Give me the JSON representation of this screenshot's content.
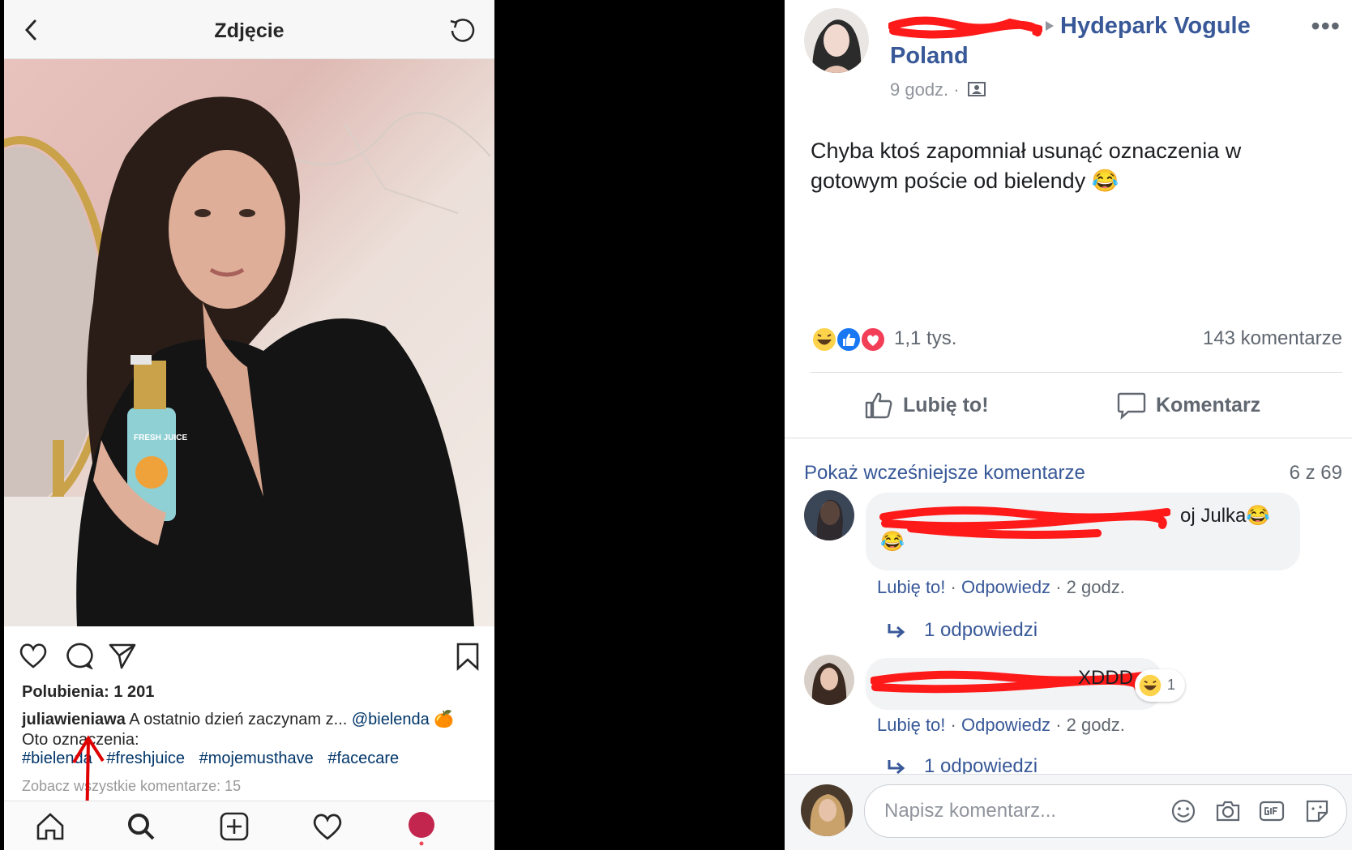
{
  "instagram": {
    "title": "Zdjęcie",
    "bottle_text": "FRESH JUICE",
    "likes": "Polubienia: 1 201",
    "caption_user": "juliawieniawa",
    "caption_text": "A ostatnio dzień zaczynam z...",
    "caption_mention": "@bielenda",
    "caption_emoji": "🍊",
    "caption_line2": "Oto oznaczenia:",
    "hashtags": [
      "#bielenda",
      "#freshjuice",
      "#mojemusthave",
      "#facecare"
    ],
    "view_all": "Zobacz wszystkie komentarze: 15"
  },
  "facebook": {
    "group_name": "Hydepark Vogule Poland",
    "post_time": "9 godz. ·",
    "post_text": "Chyba ktoś zapomniał usunąć oznaczenia w gotowym poście od bielendy 😂",
    "reactions_count": "1,1 tys.",
    "comments_count": "143 komentarze",
    "like_button": "Lubię to!",
    "comment_button": "Komentarz",
    "show_previous": "Pokaż wcześniejsze komentarze",
    "pager": "6 z 69",
    "comments": [
      {
        "text": "oj Julka😂",
        "text_line2": "😂",
        "like": "Lubię to!",
        "reply": "Odpowiedz",
        "time": "2 godz.",
        "replies": "1 odpowiedzi"
      },
      {
        "text": "XDDD",
        "reaction_count": "1",
        "like": "Lubię to!",
        "reply": "Odpowiedz",
        "time": "2 godz.",
        "replies": "1 odpowiedzi"
      }
    ],
    "input_placeholder": "Napisz komentarz..."
  },
  "colors": {
    "fb_link": "#385898",
    "ig_hashtag": "#003569",
    "redaction": "#ff0000"
  }
}
